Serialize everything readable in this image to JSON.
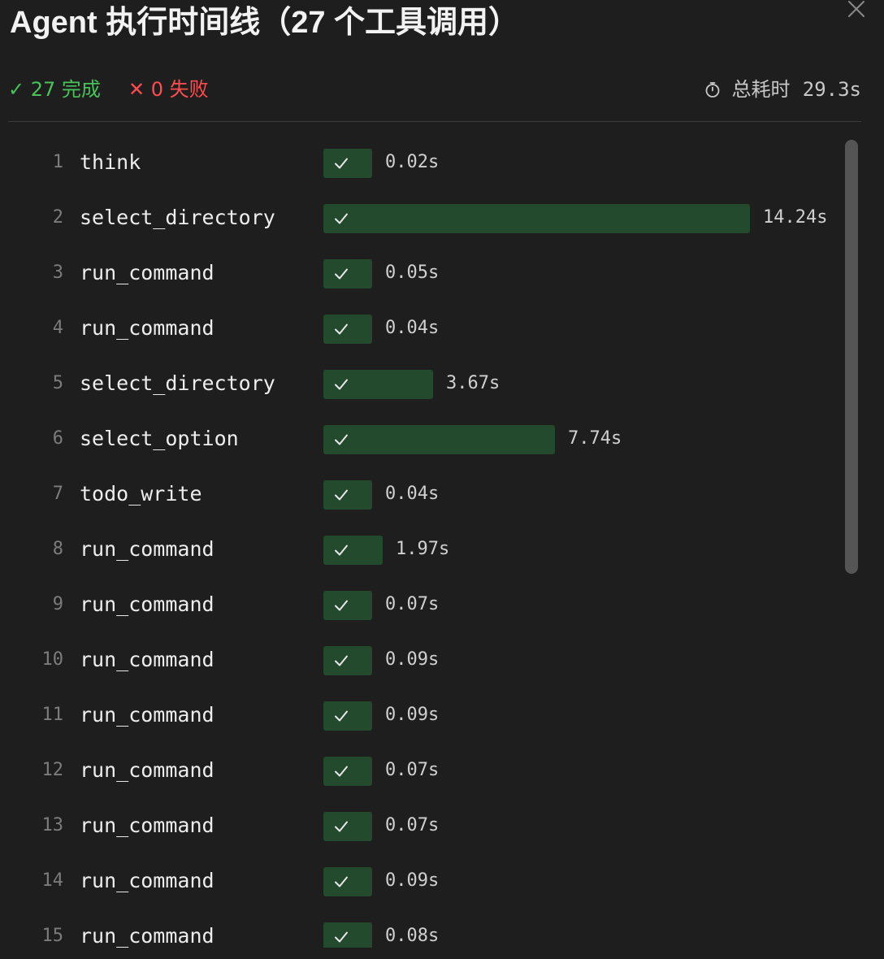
{
  "title": "Agent 执行时间线（27 个工具调用）",
  "summary": {
    "completed_label": "✓ 27 完成",
    "failed_label": "✕ 0 失败",
    "total_label": "总耗时",
    "total_value": "29.3s"
  },
  "icons": {
    "close": "close-icon",
    "clock": "stopwatch-icon",
    "check": "check-icon"
  },
  "colors": {
    "success": "#47c35a",
    "failure": "#ff4d4f",
    "bar_fill": "#234a2c"
  },
  "max_seconds": 14.24,
  "calls": [
    {
      "index": "1",
      "name": "think",
      "seconds": 0.02,
      "duration": "0.02s",
      "status": "success"
    },
    {
      "index": "2",
      "name": "select_directory",
      "seconds": 14.24,
      "duration": "14.24s",
      "status": "success"
    },
    {
      "index": "3",
      "name": "run_command",
      "seconds": 0.05,
      "duration": "0.05s",
      "status": "success"
    },
    {
      "index": "4",
      "name": "run_command",
      "seconds": 0.04,
      "duration": "0.04s",
      "status": "success"
    },
    {
      "index": "5",
      "name": "select_directory",
      "seconds": 3.67,
      "duration": "3.67s",
      "status": "success"
    },
    {
      "index": "6",
      "name": "select_option",
      "seconds": 7.74,
      "duration": "7.74s",
      "status": "success"
    },
    {
      "index": "7",
      "name": "todo_write",
      "seconds": 0.04,
      "duration": "0.04s",
      "status": "success"
    },
    {
      "index": "8",
      "name": "run_command",
      "seconds": 1.97,
      "duration": "1.97s",
      "status": "success"
    },
    {
      "index": "9",
      "name": "run_command",
      "seconds": 0.07,
      "duration": "0.07s",
      "status": "success"
    },
    {
      "index": "10",
      "name": "run_command",
      "seconds": 0.09,
      "duration": "0.09s",
      "status": "success"
    },
    {
      "index": "11",
      "name": "run_command",
      "seconds": 0.09,
      "duration": "0.09s",
      "status": "success"
    },
    {
      "index": "12",
      "name": "run_command",
      "seconds": 0.07,
      "duration": "0.07s",
      "status": "success"
    },
    {
      "index": "13",
      "name": "run_command",
      "seconds": 0.07,
      "duration": "0.07s",
      "status": "success"
    },
    {
      "index": "14",
      "name": "run_command",
      "seconds": 0.09,
      "duration": "0.09s",
      "status": "success"
    },
    {
      "index": "15",
      "name": "run_command",
      "seconds": 0.08,
      "duration": "0.08s",
      "status": "success"
    }
  ]
}
